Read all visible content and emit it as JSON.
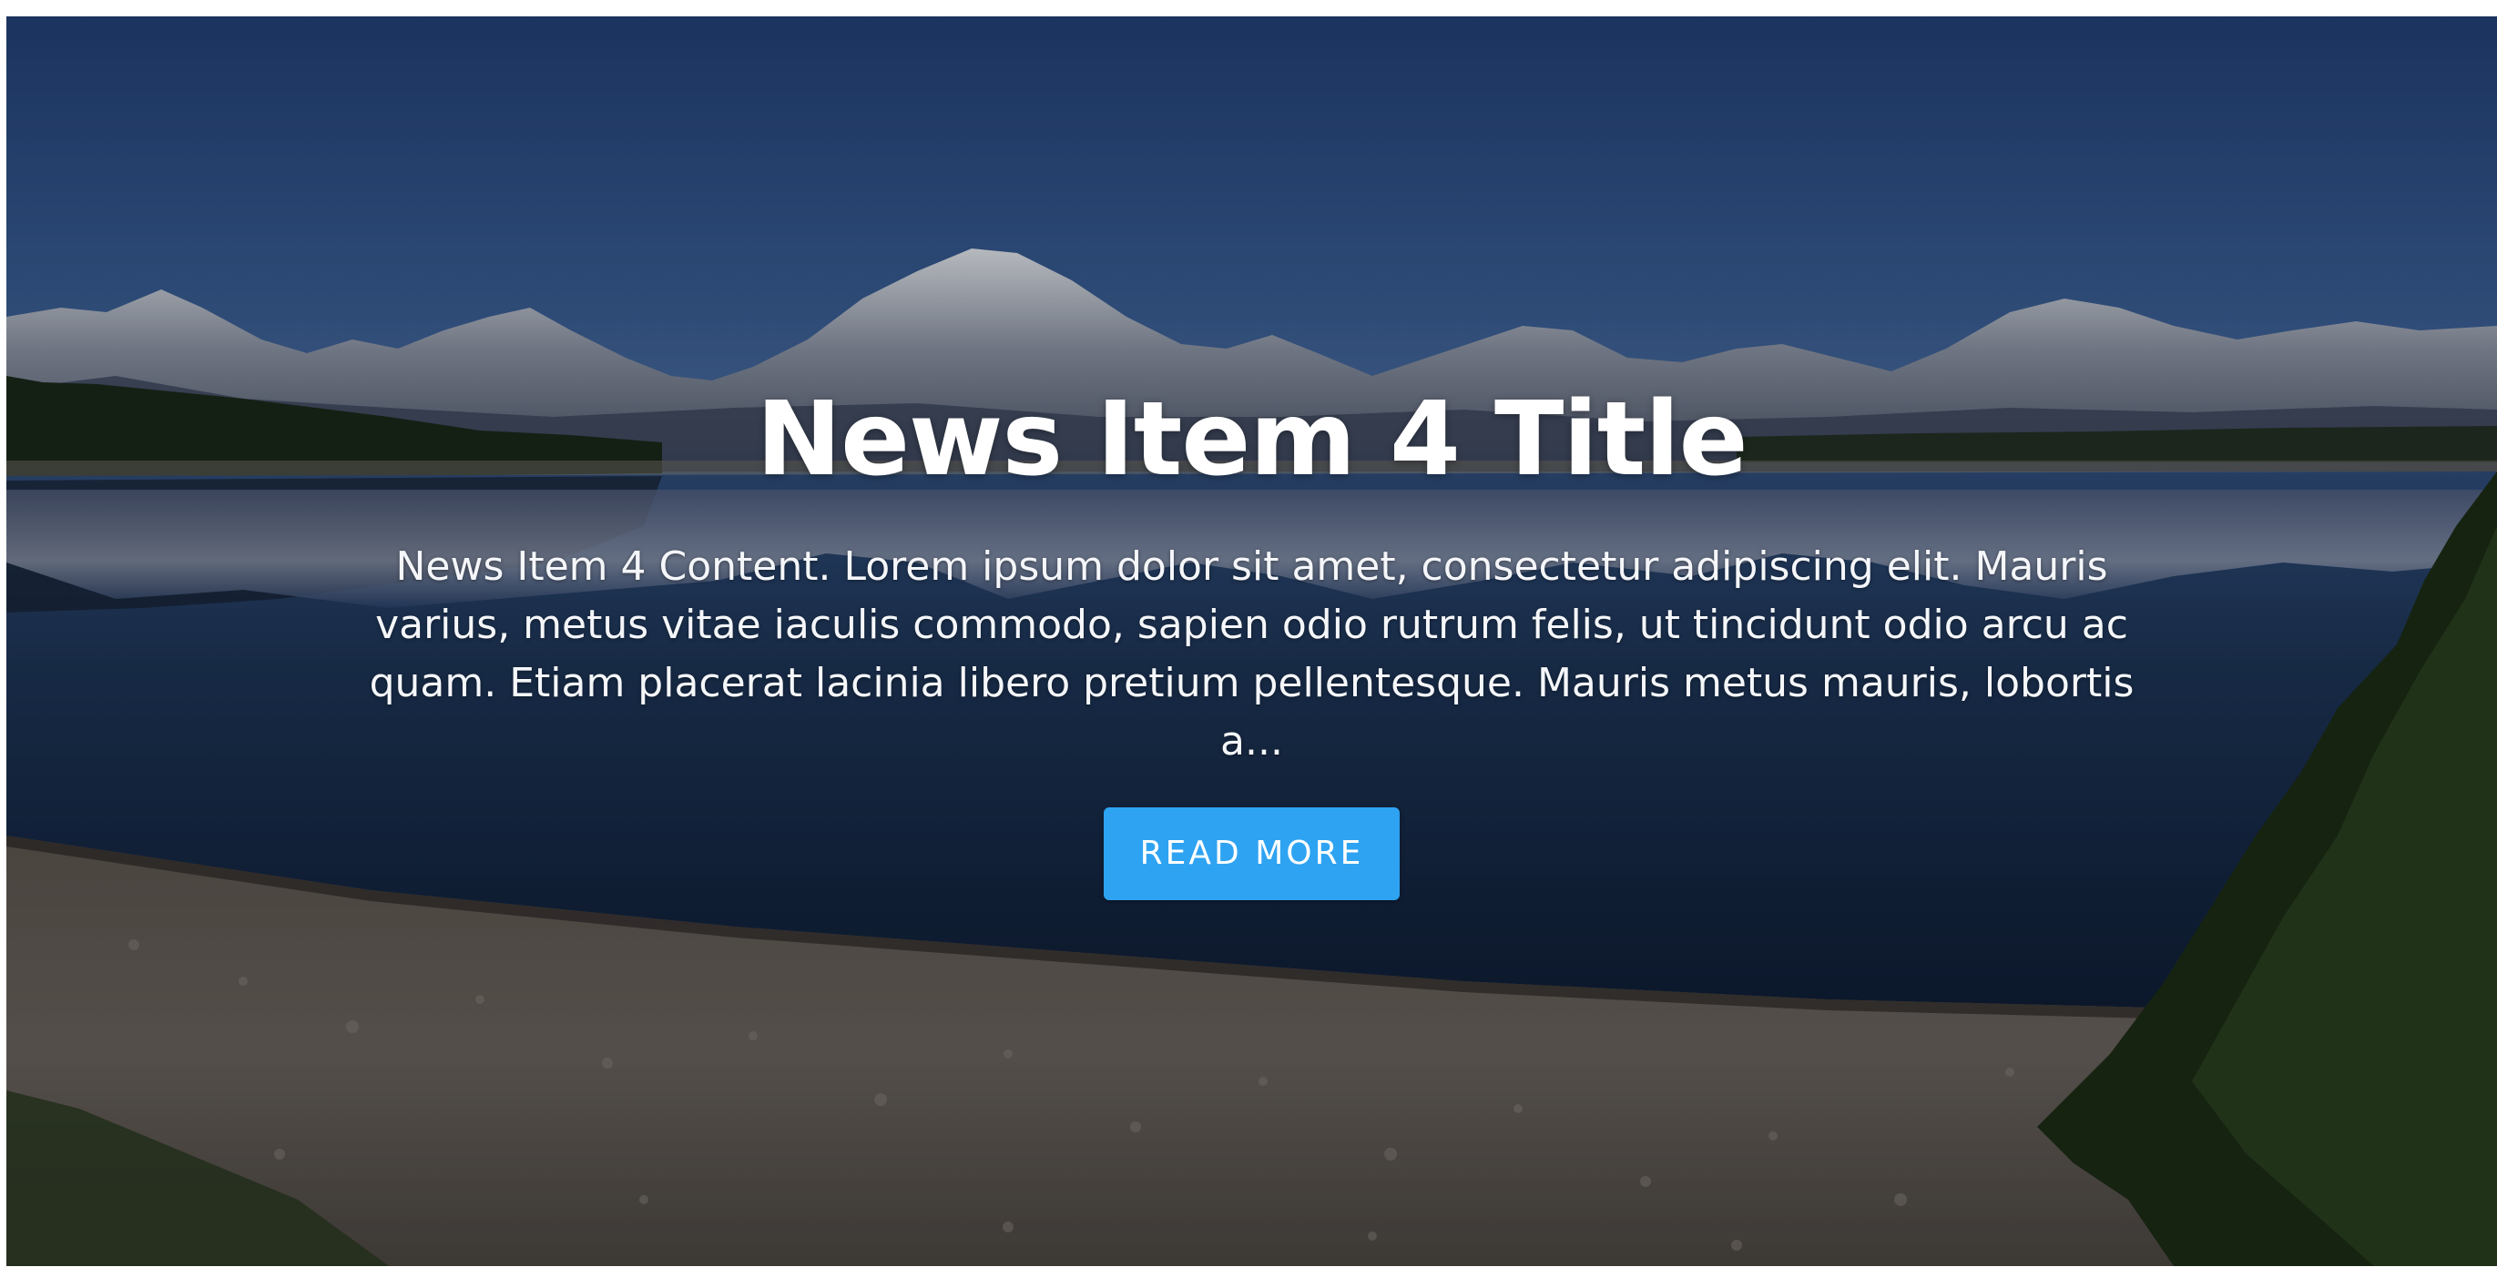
{
  "slide": {
    "title": "News Item 4 Title",
    "content": "News Item 4 Content. Lorem ipsum dolor sit amet, consectetur adipiscing elit. Mauris varius, metus vitae iaculis commodo, sapien odio rutrum felis, ut tincidunt odio arcu ac quam. Etiam placerat lacinia libero pretium pellentesque. Mauris metus mauris, lobortis a...",
    "button_label": "READ MORE"
  },
  "colors": {
    "button_bg": "#2ea3f2",
    "text": "#ffffff"
  },
  "background": {
    "image_subject": "mountain-lake-landscape"
  }
}
